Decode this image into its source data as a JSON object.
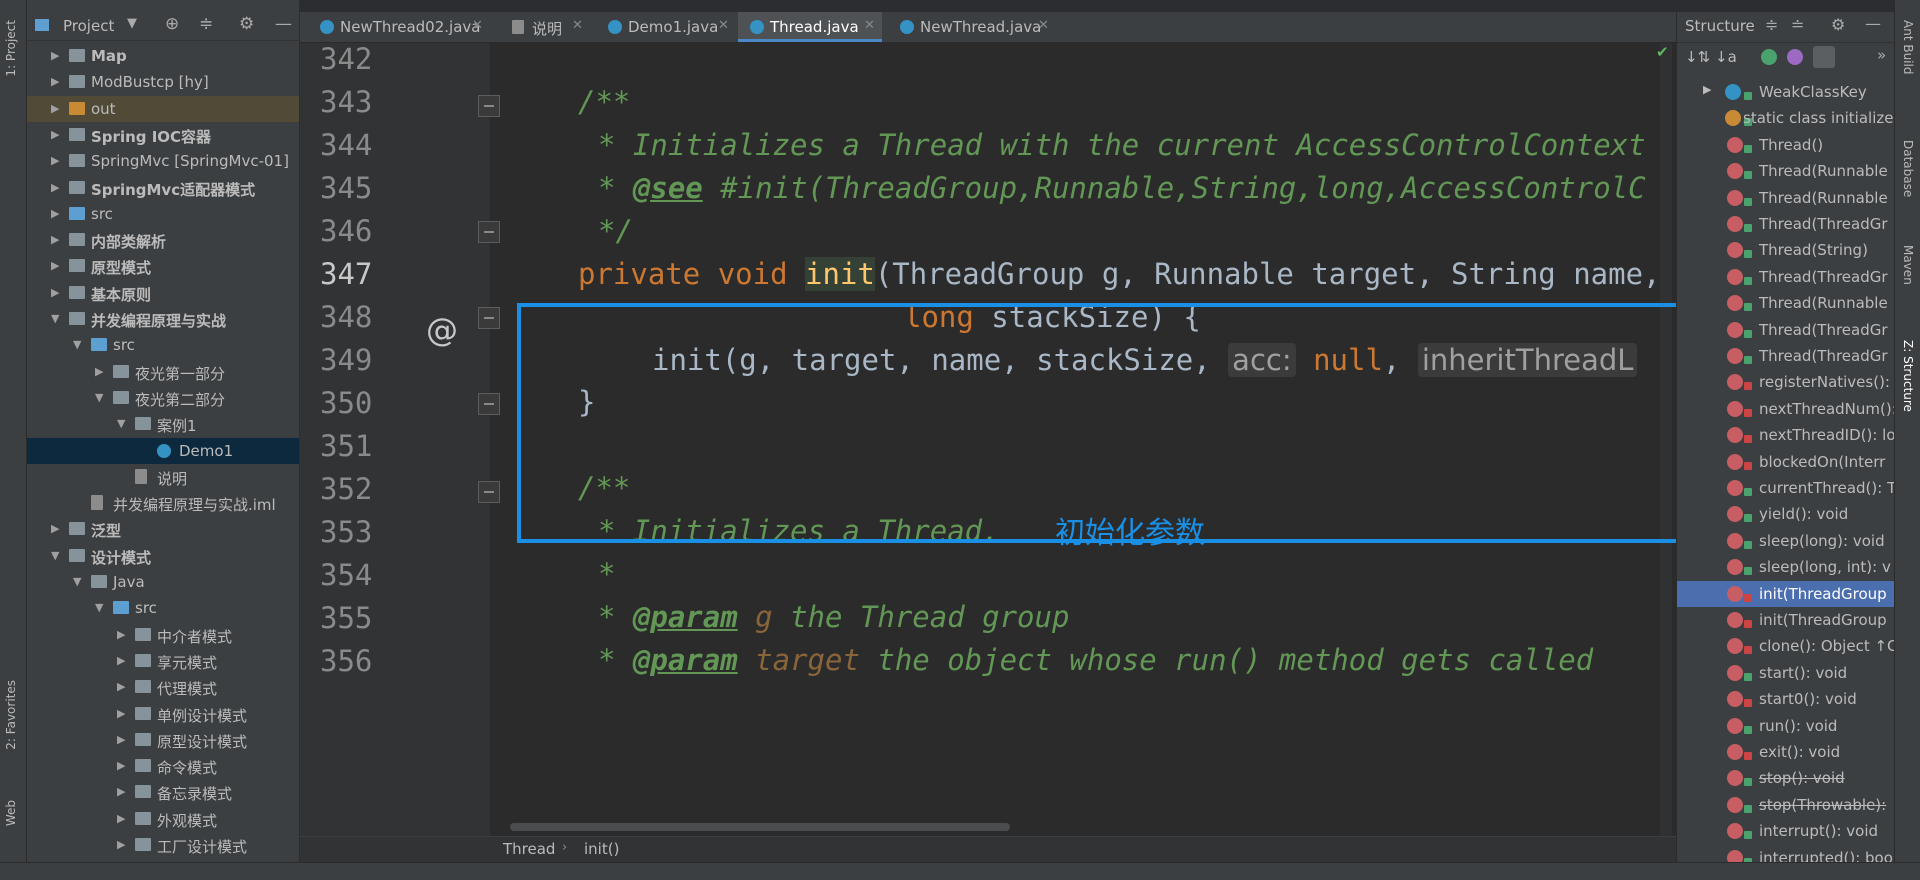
{
  "left_strip": {
    "project_tab": "1: Project",
    "favorites_tab": "2: Favorites",
    "web_tab": "Web"
  },
  "right_strip": {
    "ant_tab": "Ant Build",
    "database_tab": "Database",
    "maven_tab": "Maven",
    "structure_tab": "Z: Structure"
  },
  "project_panel": {
    "title": "Project",
    "items": [
      {
        "label": "Map",
        "bold": true
      },
      {
        "label": "ModBustcp [hy]",
        "bold": false
      },
      {
        "label": "out",
        "bold": false
      },
      {
        "label": "Spring IOC容器",
        "bold": true
      },
      {
        "label": "SpringMvc [SpringMvc-01]",
        "bold": false
      },
      {
        "label": "SpringMvc适配器模式",
        "bold": true
      },
      {
        "label": "src",
        "bold": false
      },
      {
        "label": "内部类解析",
        "bold": true
      },
      {
        "label": "原型模式",
        "bold": true
      },
      {
        "label": "基本原则",
        "bold": true
      },
      {
        "label": "并发编程原理与实战",
        "bold": true
      },
      {
        "label": "src",
        "bold": false
      },
      {
        "label": "夜光第一部分",
        "bold": false
      },
      {
        "label": "夜光第二部分",
        "bold": false
      },
      {
        "label": "案例1",
        "bold": false
      },
      {
        "label": "Demo1",
        "bold": false
      },
      {
        "label": "说明",
        "bold": false
      },
      {
        "label": "并发编程原理与实战.iml",
        "bold": false
      },
      {
        "label": "泛型",
        "bold": true
      },
      {
        "label": "设计模式",
        "bold": true
      },
      {
        "label": "Java",
        "bold": false
      },
      {
        "label": "src",
        "bold": false
      },
      {
        "label": "中介者模式",
        "bold": false
      },
      {
        "label": "享元模式",
        "bold": false
      },
      {
        "label": "代理模式",
        "bold": false
      },
      {
        "label": "单例设计模式",
        "bold": false
      },
      {
        "label": "原型设计模式",
        "bold": false
      },
      {
        "label": "命令模式",
        "bold": false
      },
      {
        "label": "备忘录模式",
        "bold": false
      },
      {
        "label": "外观模式",
        "bold": false
      },
      {
        "label": "工厂设计模式",
        "bold": false
      }
    ]
  },
  "tabs": [
    {
      "label": "NewThread02.java"
    },
    {
      "label": "说明"
    },
    {
      "label": "Demo1.java"
    },
    {
      "label": "Thread.java"
    },
    {
      "label": "NewThread.java"
    }
  ],
  "editor": {
    "line_numbers": [
      "342",
      "343",
      "344",
      "345",
      "346",
      "347",
      "348",
      "349",
      "350",
      "351",
      "352",
      "353",
      "354",
      "355",
      "356"
    ],
    "gutter_marker": "@",
    "code": {
      "l343": "/**",
      "l344": "* Initializes a Thread with the current AccessControlContext",
      "l345_star": "* ",
      "l345_tag": "@see",
      "l345_rest": " #init(ThreadGroup,Runnable,String,long,AccessControlC",
      "l346": "*/",
      "l347_kw1": "private",
      "l347_kw2": "void",
      "l347_name": "init",
      "l347_rest": "(ThreadGroup g, Runnable target, String name,",
      "l348_kw": "long",
      "l348_rest": " stackSize) {",
      "l349_call": "init(g, target, name, stackSize, ",
      "l349_hint1": "acc:",
      "l349_null": "null",
      "l349_comma": ", ",
      "l349_hint2": "inheritThreadL",
      "l350": "}",
      "l352": "/**",
      "l353": "* Initializes a Thread.",
      "l354": "*",
      "l355_star": "* ",
      "l355_tag": "@param",
      "l355_par": " g",
      "l355_rest": " the Thread group",
      "l356_star": "* ",
      "l356_tag": "@param",
      "l356_par": " target",
      "l356_rest": " the object whose run() method gets called"
    },
    "annotation": "初始化参数"
  },
  "breadcrumb": {
    "class": "Thread",
    "method": "init()"
  },
  "structure_panel": {
    "title": "Structure",
    "items": [
      {
        "label": "WeakClassKey"
      },
      {
        "label": "static class initializer"
      },
      {
        "label": "Thread()"
      },
      {
        "label": "Thread(Runnable"
      },
      {
        "label": "Thread(Runnable"
      },
      {
        "label": "Thread(ThreadGr"
      },
      {
        "label": "Thread(String)"
      },
      {
        "label": "Thread(ThreadGr"
      },
      {
        "label": "Thread(Runnable"
      },
      {
        "label": "Thread(ThreadGr"
      },
      {
        "label": "Thread(ThreadGr"
      },
      {
        "label": "registerNatives(): "
      },
      {
        "label": "nextThreadNum(): "
      },
      {
        "label": "nextThreadID(): lo"
      },
      {
        "label": "blockedOn(Interr"
      },
      {
        "label": "currentThread(): T"
      },
      {
        "label": "yield(): void"
      },
      {
        "label": "sleep(long): void"
      },
      {
        "label": "sleep(long, int): v"
      },
      {
        "label": "init(ThreadGroup"
      },
      {
        "label": "init(ThreadGroup"
      },
      {
        "label": "clone(): Object ↑C"
      },
      {
        "label": "start(): void"
      },
      {
        "label": "start0(): void"
      },
      {
        "label": "run(): void"
      },
      {
        "label": "exit(): void"
      },
      {
        "label": "stop(): void"
      },
      {
        "label": "stop(Throwable): "
      },
      {
        "label": "interrupt(): void"
      },
      {
        "label": "interrupted(): boo"
      }
    ]
  },
  "colors": {
    "accent": "#1a8fe6",
    "selection": "#4b6eaf",
    "comment": "#629755",
    "keyword": "#cc7832"
  }
}
